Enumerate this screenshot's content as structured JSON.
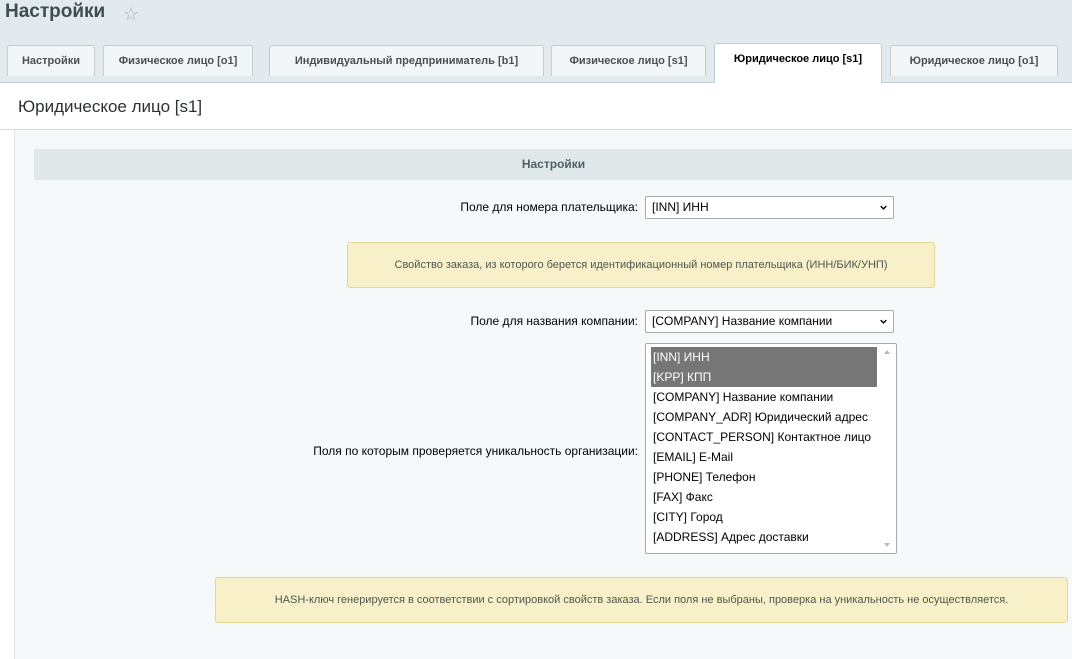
{
  "page": {
    "title": "Настройки"
  },
  "tabs": [
    {
      "label": "Настройки"
    },
    {
      "label": "Физическое лицо [o1]"
    },
    {
      "label": "Индивидуальный предприниматель [b1]"
    },
    {
      "label": "Физическое лицо [s1]"
    },
    {
      "label": "Юридическое лицо [s1]"
    },
    {
      "label": "Юридическое лицо [o1]"
    }
  ],
  "active_tab": "Юридическое лицо [s1]",
  "panel": {
    "title": "Юридическое лицо [s1]",
    "section_header": "Настройки",
    "payer_field": {
      "label": "Поле для номера плательщика:",
      "value": "[INN] ИНН",
      "hint": "Свойство заказа, из которого берется идентификационный номер плательщика (ИНН/БИК/УНП)"
    },
    "company_field": {
      "label": "Поле для названия компании:",
      "value": "[COMPANY] Название компании"
    },
    "unique_fields": {
      "label": "Поля по которым проверяется уникальность организации:",
      "options": [
        {
          "label": "[INN] ИНН",
          "selected": true
        },
        {
          "label": "[KPP] КПП",
          "selected": true
        },
        {
          "label": "[COMPANY] Название компании",
          "selected": false
        },
        {
          "label": "[COMPANY_ADR] Юридический адрес",
          "selected": false
        },
        {
          "label": "[CONTACT_PERSON] Контактное лицо",
          "selected": false
        },
        {
          "label": "[EMAIL] E-Mail",
          "selected": false
        },
        {
          "label": "[PHONE] Телефон",
          "selected": false
        },
        {
          "label": "[FAX] Факс",
          "selected": false
        },
        {
          "label": "[CITY] Город",
          "selected": false
        },
        {
          "label": "[ADDRESS] Адрес доставки",
          "selected": false
        }
      ],
      "hint": "HASH-ключ генерируется в соответствии с сортировкой свойств заказа. Если поля не выбраны, проверка на уникальность не осуществляется."
    }
  }
}
